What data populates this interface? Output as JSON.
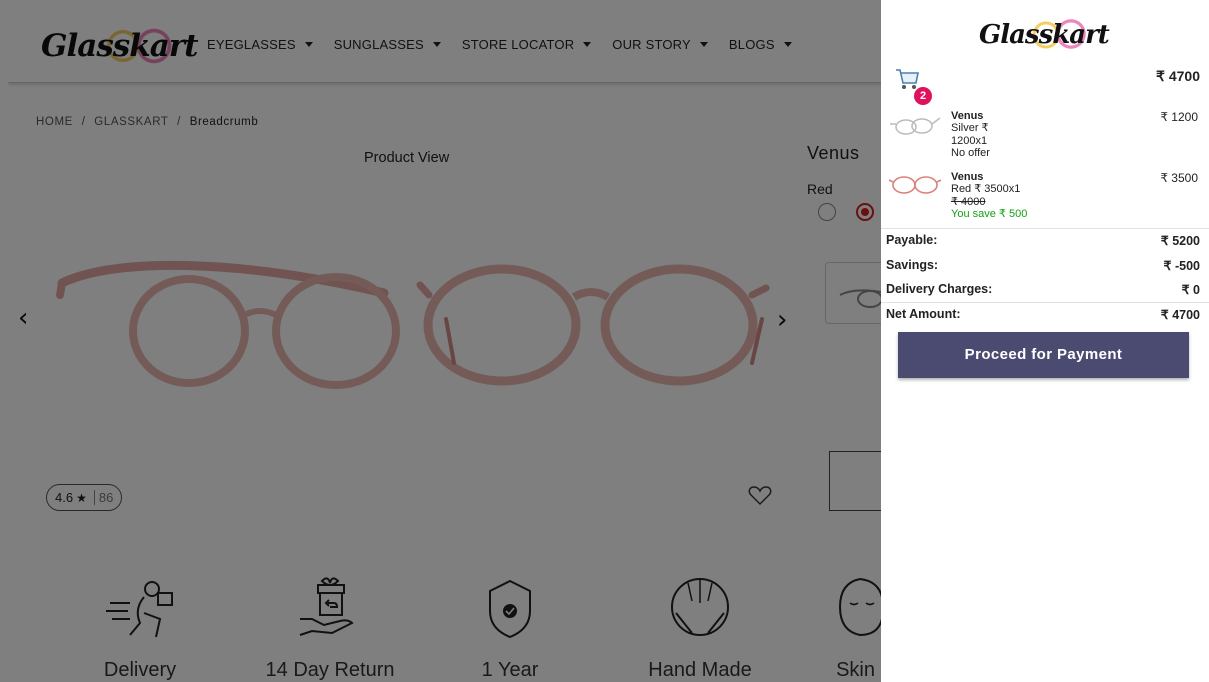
{
  "brand": {
    "logo_text": "Glasskart"
  },
  "nav": {
    "items": [
      {
        "label": "EYEGLASSES"
      },
      {
        "label": "SUNGLASSES"
      },
      {
        "label": "STORE LOCATOR"
      },
      {
        "label": "OUR STORY"
      },
      {
        "label": "BLOGS"
      }
    ]
  },
  "breadcrumb": {
    "items": [
      "HOME",
      "GLASSKART",
      "Breadcrumb"
    ],
    "separator": "/"
  },
  "product": {
    "view_label": "Product View",
    "name": "Venus",
    "color_label": "Red",
    "rating": "4.6",
    "review_count": "86",
    "prev_label": "‹",
    "next_label": "›"
  },
  "features": [
    {
      "label": "Delivery",
      "icon": "delivery-icon"
    },
    {
      "label": "14 Day Return",
      "icon": "return-gift-icon"
    },
    {
      "label": "1 Year",
      "icon": "warranty-shield-icon"
    },
    {
      "label": "Hand Made",
      "icon": "handmade-icon"
    },
    {
      "label": "Skin Fri",
      "icon": "skin-friendly-icon"
    }
  ],
  "cart": {
    "logo_text": "Glasskart",
    "count": "2",
    "total": "₹ 4700",
    "items": [
      {
        "name": "Venus",
        "line1": "Silver  ₹",
        "line2": "1200x1",
        "line3": "No offer",
        "price": "₹ 1200",
        "frame_color": "#b9bcc0"
      },
      {
        "name": "Venus",
        "line1": "Red  ₹ 3500x1",
        "line2": "₹ 4000",
        "line3": "You save ₹ 500",
        "price": "₹ 3500",
        "frame_color": "#d9837a"
      }
    ],
    "summary": [
      {
        "label": "Payable:",
        "value": "₹ 5200"
      },
      {
        "label": "Savings:",
        "value": "₹ -500"
      },
      {
        "label": "Delivery Charges:",
        "value": "₹ 0"
      },
      {
        "label": "Net Amount:",
        "value": "₹ 4700"
      }
    ],
    "cta_label": "Proceed for Payment"
  },
  "colors": {
    "accent_button": "#4b4b72",
    "badge": "#e0115f",
    "save_text": "#14a114",
    "selected_radio": "#d21f1f"
  }
}
